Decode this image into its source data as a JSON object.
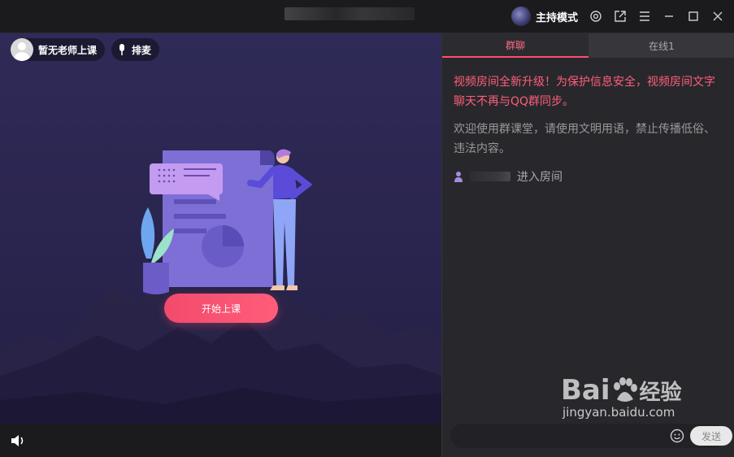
{
  "titlebar": {
    "mode_label": "主持模式",
    "icons": [
      "settings-icon",
      "share-icon",
      "menu-icon",
      "minimize-icon",
      "maximize-icon",
      "close-icon"
    ]
  },
  "stage": {
    "teacher_label": "暂无老师上课",
    "queue_label": "排麦",
    "start_button": "开始上课"
  },
  "chat": {
    "tabs": [
      {
        "label": "群聊",
        "active": true
      },
      {
        "label": "在线1",
        "active": false
      }
    ],
    "notice": "视频房间全新升级！为保护信息安全，视频房间文字聊天不再与QQ群同步。",
    "welcome": "欢迎使用群课堂，请使用文明用语，禁止传播低俗、违法内容。",
    "enter_text": "进入房间",
    "send_label": "发送"
  },
  "watermark": {
    "brand": "Bai",
    "brand_cn": "经验",
    "url": "jingyan.baidu.com"
  },
  "colors": {
    "accent": "#ff4d6d",
    "notice_text": "#ff5e7a",
    "stage_bg": "#2b2650",
    "panel_bg": "#28282c"
  }
}
